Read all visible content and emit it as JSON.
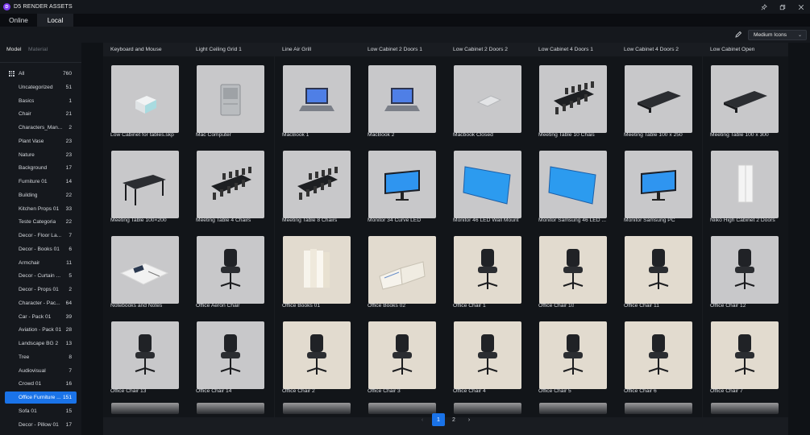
{
  "app": {
    "title": "D5 RENDER ASSETS",
    "logo_letter": "D"
  },
  "window_controls": [
    "pin-icon",
    "restore-icon",
    "close-icon"
  ],
  "top_tabs": [
    "Online",
    "Local"
  ],
  "toolbar": {
    "view_mode": "Medium Icons"
  },
  "sidebar": {
    "tabs": [
      "Model",
      "Material"
    ],
    "categories": [
      {
        "label": "All",
        "count": "760"
      },
      {
        "label": "Uncategorized",
        "count": "51"
      },
      {
        "label": "Basics",
        "count": "1"
      },
      {
        "label": "Chair",
        "count": "21"
      },
      {
        "label": "Characters_Man...",
        "count": "2"
      },
      {
        "label": "Plant Vase",
        "count": "23"
      },
      {
        "label": "Nature",
        "count": "23"
      },
      {
        "label": "Background",
        "count": "17"
      },
      {
        "label": "Furniture 01",
        "count": "14"
      },
      {
        "label": "Building",
        "count": "22"
      },
      {
        "label": "Kitchen Props 01",
        "count": "33"
      },
      {
        "label": "Teste Categoria",
        "count": "22"
      },
      {
        "label": "Decor - Floor La...",
        "count": "7"
      },
      {
        "label": "Decor - Books 01",
        "count": "6"
      },
      {
        "label": "Armchair",
        "count": "11"
      },
      {
        "label": "Decor - Curtain ...",
        "count": "5"
      },
      {
        "label": "Decor - Props 01",
        "count": "2"
      },
      {
        "label": "Character - Pac...",
        "count": "64"
      },
      {
        "label": "Car - Pack 01",
        "count": "39"
      },
      {
        "label": "Aviation - Pack 01",
        "count": "28"
      },
      {
        "label": "Landscape BG 2",
        "count": "13"
      },
      {
        "label": "Tree",
        "count": "8"
      },
      {
        "label": "Audiovisual",
        "count": "7"
      },
      {
        "label": "Crowd 01",
        "count": "16"
      },
      {
        "label": "Office Furniture ...",
        "count": "151"
      },
      {
        "label": "Sofa 01",
        "count": "15"
      },
      {
        "label": "Decor - Pillow 01",
        "count": "17"
      }
    ]
  },
  "top_labels": [
    "Keyboard and Mouse",
    "Light Ceiling Grid 1",
    "Line Air Grill",
    "Low Cabinet 2 Doors 1",
    "Low Cabinet 2 Doors 2",
    "Low Cabinet 4 Doors 1",
    "Low Cabinet 4 Doors 2",
    "Low Cabinet Open"
  ],
  "assets": [
    {
      "name": "Low Cabinet for tables.skp",
      "bg": "grey",
      "icon": "cabinet-icon"
    },
    {
      "name": "Mac Computer",
      "bg": "grey",
      "icon": "computer-tower-icon"
    },
    {
      "name": "MacBook 1",
      "bg": "grey",
      "icon": "laptop-icon"
    },
    {
      "name": "MacBook 2",
      "bg": "grey",
      "icon": "laptop-icon"
    },
    {
      "name": "Macbook Closed",
      "bg": "grey",
      "icon": "laptop-closed-icon"
    },
    {
      "name": "Meeting Table 10 Chais",
      "bg": "grey",
      "icon": "meeting-table-icon"
    },
    {
      "name": "Meeting Table 100 x 250",
      "bg": "grey",
      "icon": "table-icon"
    },
    {
      "name": "Meeting Table 100 x 300",
      "bg": "grey",
      "icon": "table-icon"
    },
    {
      "name": "Meeting Table 100×200",
      "bg": "grey",
      "icon": "desk-icon"
    },
    {
      "name": "Meeting Table 4 Chairs",
      "bg": "grey",
      "icon": "meeting-table-icon"
    },
    {
      "name": "Meeting Table 8 Chairs",
      "bg": "grey",
      "icon": "meeting-table-icon"
    },
    {
      "name": "Monitor 34 Curve LED",
      "bg": "grey",
      "icon": "monitor-icon"
    },
    {
      "name": "Monitor 46 LED Wall Mount",
      "bg": "grey",
      "icon": "wall-monitor-icon"
    },
    {
      "name": "Monitor Samsung 46 LED ...",
      "bg": "grey",
      "icon": "wall-monitor-icon"
    },
    {
      "name": "Monitor Samsung PC",
      "bg": "grey",
      "icon": "monitor-icon"
    },
    {
      "name": "Niiko High Cabinet 2 Doors",
      "bg": "grey",
      "icon": "tall-cabinet-icon"
    },
    {
      "name": "Notebooks and Notes",
      "bg": "grey",
      "icon": "notebook-icon"
    },
    {
      "name": "Office Aeron Chair",
      "bg": "grey",
      "icon": "office-chair-icon"
    },
    {
      "name": "Office Books 01",
      "bg": "beige",
      "icon": "books-icon"
    },
    {
      "name": "Office Books 02",
      "bg": "beige",
      "icon": "open-book-icon"
    },
    {
      "name": "Office Chair 1",
      "bg": "beige",
      "icon": "office-chair-icon"
    },
    {
      "name": "Office Chair 10",
      "bg": "beige",
      "icon": "office-chair-icon"
    },
    {
      "name": "Office Chair 11",
      "bg": "beige",
      "icon": "office-chair-icon"
    },
    {
      "name": "Office Chair 12",
      "bg": "grey",
      "icon": "office-chair-icon"
    },
    {
      "name": "Office Chair 13",
      "bg": "grey",
      "icon": "office-chair-icon"
    },
    {
      "name": "Office Chair 14",
      "bg": "grey",
      "icon": "office-chair-icon"
    },
    {
      "name": "Office Chair 2",
      "bg": "beige",
      "icon": "office-chair-icon"
    },
    {
      "name": "Office Chair 3",
      "bg": "beige",
      "icon": "office-chair-icon"
    },
    {
      "name": "Office Chair 4",
      "bg": "beige",
      "icon": "office-chair-icon"
    },
    {
      "name": "Office Chair 5",
      "bg": "beige",
      "icon": "office-chair-icon"
    },
    {
      "name": "Office Chair 6",
      "bg": "beige",
      "icon": "office-chair-icon"
    },
    {
      "name": "Office Chair 7",
      "bg": "beige",
      "icon": "office-chair-icon"
    }
  ],
  "pagination": {
    "prev": "‹",
    "pages": [
      "1",
      "2"
    ],
    "next": "›"
  },
  "colors": {
    "accent": "#1a73e8",
    "background": "#101318",
    "panel": "#15181d",
    "thumb_grey": "#c8c8ca",
    "thumb_beige": "#e2dbcf",
    "logo": "#7e3cf0"
  }
}
